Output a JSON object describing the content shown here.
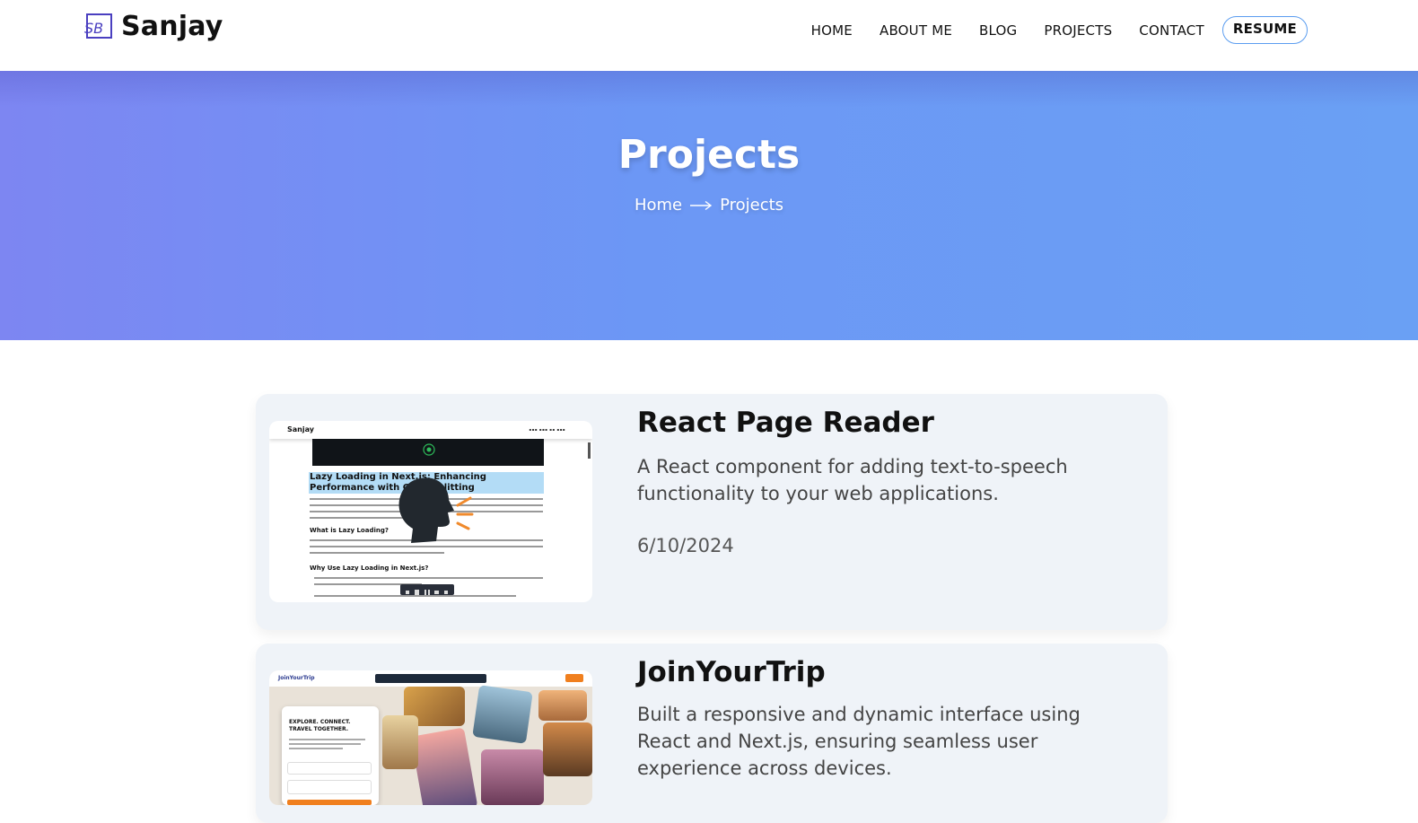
{
  "header": {
    "logo_text": "Sanjay",
    "logo_mark": "SB",
    "nav": [
      "HOME",
      "ABOUT ME",
      "BLOG",
      "PROJECTS",
      "CONTACT"
    ],
    "resume_label": "RESUME"
  },
  "hero": {
    "title": "Projects",
    "breadcrumb_home": "Home",
    "breadcrumb_current": "Projects"
  },
  "projects": [
    {
      "title": "React Page Reader",
      "description": "A React component for adding text-to-speech functionality to your web applications.",
      "date": "6/10/2024",
      "thumbnail": {
        "brand": "Sanjay",
        "heading": "Lazy Loading in Next.js: Enhancing Performance with Code Splitting",
        "sub1": "What is Lazy Loading?",
        "sub2": "Why Use Lazy Loading in Next.js?"
      }
    },
    {
      "title": "JoinYourTrip",
      "description": "Built a responsive and dynamic interface using React and Next.js, ensuring seamless user experience across devices.",
      "thumbnail": {
        "brand": "JoinYourTrip",
        "panel_title": "EXPLORE. CONNECT. TRAVEL TOGETHER."
      }
    }
  ],
  "colors": {
    "hero_left": "#7d86f2",
    "hero_right": "#6aa0f4",
    "resume_accent": "#4b8fe6",
    "card_bg": "#eff3f8"
  }
}
